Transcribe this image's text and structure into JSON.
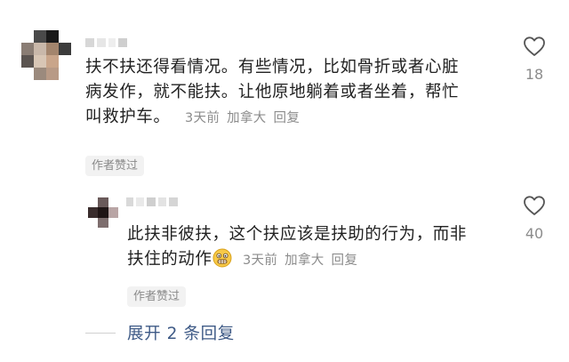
{
  "comments": [
    {
      "id": "top",
      "text_lines": [
        "扶不扶还得看情况。有些情况，比如骨折或者心脏",
        "病发作，就不能扶。让他原地躺着或者坐着，帮忙",
        "叫救护车。"
      ],
      "time": "3天前",
      "location": "加拿大",
      "reply_label": "回复",
      "author_liked": "作者赞过",
      "like_count": "18",
      "avatar_colors": [
        "#ffffff",
        "#4a4a4a",
        "#1a1a1a",
        "#ffffff",
        "#8a7d74",
        "#c9b8aa",
        "#a3856d",
        "#3b3b3b",
        "#5b5450",
        "#d8c6b5",
        "#c9a58a",
        "#ffffff",
        "#ffffff",
        "#9b8a7d",
        "#b89a86",
        "#ffffff"
      ]
    },
    {
      "id": "reply",
      "text_lines": [
        "此扶非彼扶，这个扶应该是扶助的行为，而非",
        "扶住的动作"
      ],
      "emoji": "grimacing-face-icon",
      "time": "3天前",
      "location": "加拿大",
      "reply_label": "回复",
      "author_liked": "作者赞过",
      "like_count": "40",
      "avatar_colors": [
        "#ffffff",
        "#6a5a5a",
        "#ffffff",
        "#3a2d2d",
        "#1f1515",
        "#b9a5a5",
        "#ffffff",
        "#7d6d6d",
        "#ffffff"
      ]
    }
  ],
  "expand_replies": "展开 2 条回复"
}
